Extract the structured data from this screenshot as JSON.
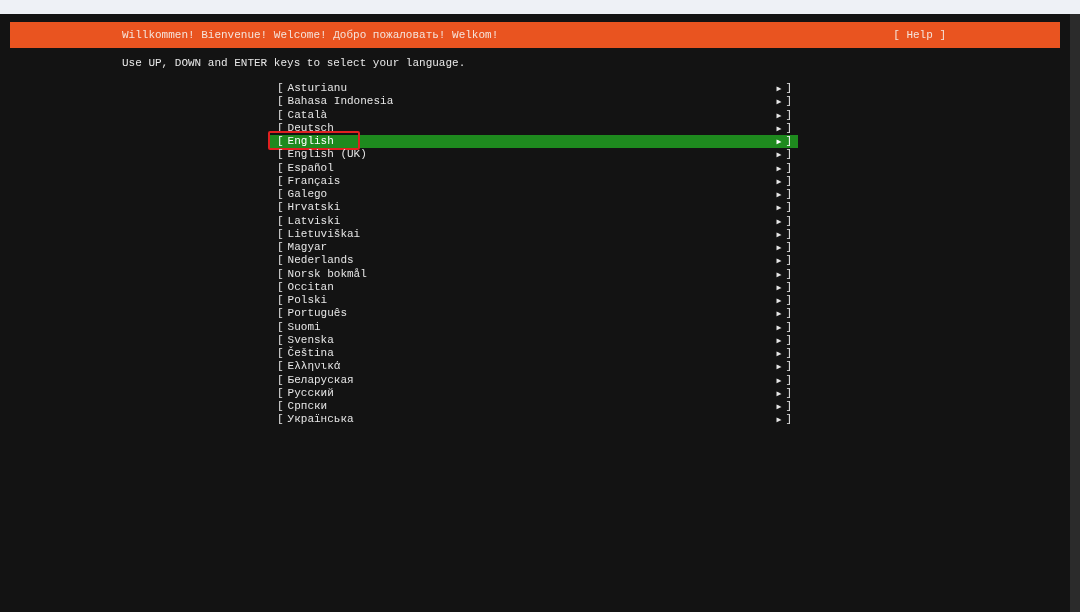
{
  "header": {
    "title": "Willkommen! Bienvenue! Welcome! Добро пожаловать! Welkom!",
    "help": "[ Help ]"
  },
  "instruction": "Use UP, DOWN and ENTER keys to select your language.",
  "languages": [
    {
      "left": "[",
      "label": "Asturianu",
      "arrow": "▶",
      "right": "]",
      "selected": false
    },
    {
      "left": "[",
      "label": "Bahasa Indonesia",
      "arrow": "▶",
      "right": "]",
      "selected": false
    },
    {
      "left": "[",
      "label": "Català",
      "arrow": "▶",
      "right": "]",
      "selected": false
    },
    {
      "left": "[",
      "label": "Deutsch",
      "arrow": "▶",
      "right": "]",
      "selected": false
    },
    {
      "left": "[",
      "label": "English",
      "arrow": "▶",
      "right": "]",
      "selected": true
    },
    {
      "left": "[",
      "label": "English (UK)",
      "arrow": "▶",
      "right": "]",
      "selected": false
    },
    {
      "left": "[",
      "label": "Español",
      "arrow": "▶",
      "right": "]",
      "selected": false
    },
    {
      "left": "[",
      "label": "Français",
      "arrow": "▶",
      "right": "]",
      "selected": false
    },
    {
      "left": "[",
      "label": "Galego",
      "arrow": "▶",
      "right": "]",
      "selected": false
    },
    {
      "left": "[",
      "label": "Hrvatski",
      "arrow": "▶",
      "right": "]",
      "selected": false
    },
    {
      "left": "[",
      "label": "Latviski",
      "arrow": "▶",
      "right": "]",
      "selected": false
    },
    {
      "left": "[",
      "label": "Lietuviškai",
      "arrow": "▶",
      "right": "]",
      "selected": false
    },
    {
      "left": "[",
      "label": "Magyar",
      "arrow": "▶",
      "right": "]",
      "selected": false
    },
    {
      "left": "[",
      "label": "Nederlands",
      "arrow": "▶",
      "right": "]",
      "selected": false
    },
    {
      "left": "[",
      "label": "Norsk bokmål",
      "arrow": "▶",
      "right": "]",
      "selected": false
    },
    {
      "left": "[",
      "label": "Occitan",
      "arrow": "▶",
      "right": "]",
      "selected": false
    },
    {
      "left": "[",
      "label": "Polski",
      "arrow": "▶",
      "right": "]",
      "selected": false
    },
    {
      "left": "[",
      "label": "Português",
      "arrow": "▶",
      "right": "]",
      "selected": false
    },
    {
      "left": "[",
      "label": "Suomi",
      "arrow": "▶",
      "right": "]",
      "selected": false
    },
    {
      "left": "[",
      "label": "Svenska",
      "arrow": "▶",
      "right": "]",
      "selected": false
    },
    {
      "left": "[",
      "label": "Čeština",
      "arrow": "▶",
      "right": "]",
      "selected": false
    },
    {
      "left": "[",
      "label": "Ελληνικά",
      "arrow": "▶",
      "right": "]",
      "selected": false
    },
    {
      "left": "[",
      "label": "Беларуская",
      "arrow": "▶",
      "right": "]",
      "selected": false
    },
    {
      "left": "[",
      "label": "Русский",
      "arrow": "▶",
      "right": "]",
      "selected": false
    },
    {
      "left": "[",
      "label": "Српски",
      "arrow": "▶",
      "right": "]",
      "selected": false
    },
    {
      "left": "[",
      "label": "Українська",
      "arrow": "▶",
      "right": "]",
      "selected": false
    }
  ]
}
